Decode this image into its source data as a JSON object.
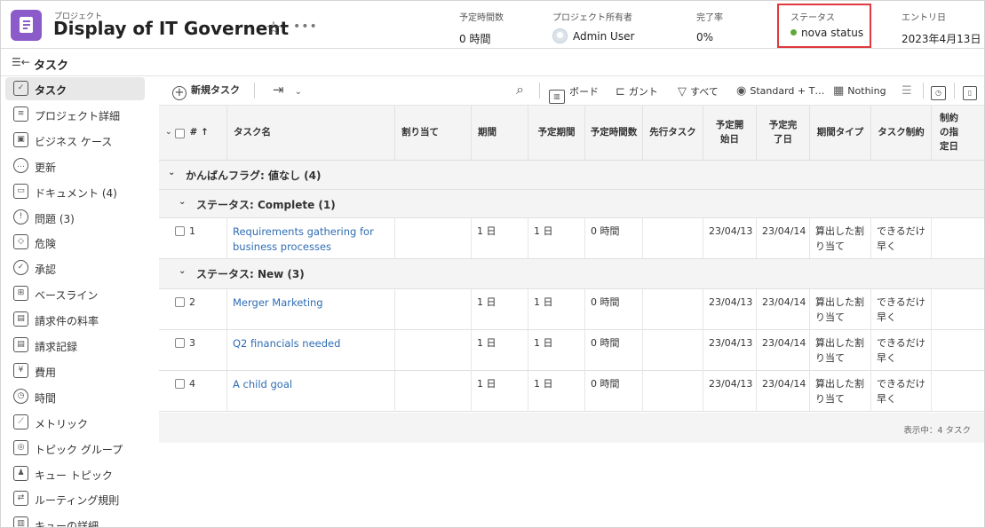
{
  "header": {
    "kicker": "プロジェクト",
    "title": "Display of IT Governent",
    "more": "•••",
    "stats": {
      "planned_hours": {
        "label": "予定時間数",
        "value": "0 時間"
      },
      "owner": {
        "label": "プロジェクト所有者",
        "value": "Admin User"
      },
      "percent_complete": {
        "label": "完了率",
        "value": "0%"
      },
      "status": {
        "label": "ステータス",
        "value": "nova status",
        "color": "#5ea83a"
      },
      "entry_date": {
        "label": "エントリ日",
        "value": "2023年4月13日"
      }
    }
  },
  "nav_section": {
    "title": "タスク"
  },
  "sidebar": {
    "items": [
      {
        "label": "タスク",
        "icon": "clipboard-check-icon",
        "active": true
      },
      {
        "label": "プロジェクト詳細",
        "icon": "document-lines-icon"
      },
      {
        "label": "ビジネス ケース",
        "icon": "briefcase-icon"
      },
      {
        "label": "更新",
        "icon": "chat-bubble-icon"
      },
      {
        "label": "ドキュメント (4)",
        "icon": "page-icon"
      },
      {
        "label": "問題 (3)",
        "icon": "alert-circle-icon"
      },
      {
        "label": "危険",
        "icon": "alert-diamond-icon"
      },
      {
        "label": "承認",
        "icon": "check-circle-icon"
      },
      {
        "label": "ベースライン",
        "icon": "baseline-icon"
      },
      {
        "label": "請求件の料率",
        "icon": "rate-table-icon"
      },
      {
        "label": "請求記録",
        "icon": "billing-record-icon"
      },
      {
        "label": "費用",
        "icon": "money-icon"
      },
      {
        "label": "時間",
        "icon": "clock-icon"
      },
      {
        "label": "メトリック",
        "icon": "line-chart-icon"
      },
      {
        "label": "トピック グループ",
        "icon": "topic-group-icon"
      },
      {
        "label": "キュー トピック",
        "icon": "queue-topic-icon"
      },
      {
        "label": "ルーティング規則",
        "icon": "routing-icon"
      },
      {
        "label": "キューの詳細",
        "icon": "queue-details-icon"
      }
    ]
  },
  "toolbar": {
    "new_task": "新規タスク",
    "board": "ボード",
    "gantt": "ガント",
    "filter": "すべて",
    "view": "Standard + T…",
    "grouping": "Nothing"
  },
  "table": {
    "columns": {
      "number": "# ↑",
      "name": "タスク名",
      "assigned": "割り当て",
      "duration": "期間",
      "planned_duration": "予定期間",
      "planned_hours": "予定時間数",
      "predecessors": "先行タスク",
      "planned_start": "予定開始日",
      "planned_completion": "予定完了日",
      "duration_type": "期間タイプ",
      "task_constraint": "タスク制約",
      "constraint_date": "制約の指定日"
    },
    "groups": {
      "kanban": "かんばんフラグ: 値なし (4)",
      "complete": "ステータス: Complete (1)",
      "new": "ステータス: New (3)"
    },
    "rows": [
      {
        "num": "1",
        "name": "Requirements gathering for business processes",
        "duration": "1 日",
        "planned_duration": "1 日",
        "planned_hours": "0 時間",
        "planned_start": "23/04/13",
        "planned_completion": "23/04/14",
        "duration_type": "算出した割り当て",
        "task_constraint": "できるだけ早く"
      },
      {
        "num": "2",
        "name": "Merger Marketing",
        "duration": "1 日",
        "planned_duration": "1 日",
        "planned_hours": "0 時間",
        "planned_start": "23/04/13",
        "planned_completion": "23/04/14",
        "duration_type": "算出した割り当て",
        "task_constraint": "できるだけ早く"
      },
      {
        "num": "3",
        "name": "Q2 financials needed",
        "duration": "1 日",
        "planned_duration": "1 日",
        "planned_hours": "0 時間",
        "planned_start": "23/04/13",
        "planned_completion": "23/04/14",
        "duration_type": "算出した割り当て",
        "task_constraint": "できるだけ早く"
      },
      {
        "num": "4",
        "name": "A child goal",
        "duration": "1 日",
        "planned_duration": "1 日",
        "planned_hours": "0 時間",
        "planned_start": "23/04/13",
        "planned_completion": "23/04/14",
        "duration_type": "算出した割り当て",
        "task_constraint": "できるだけ早く"
      }
    ]
  },
  "footer": {
    "count": "表示中：4 タスク"
  }
}
